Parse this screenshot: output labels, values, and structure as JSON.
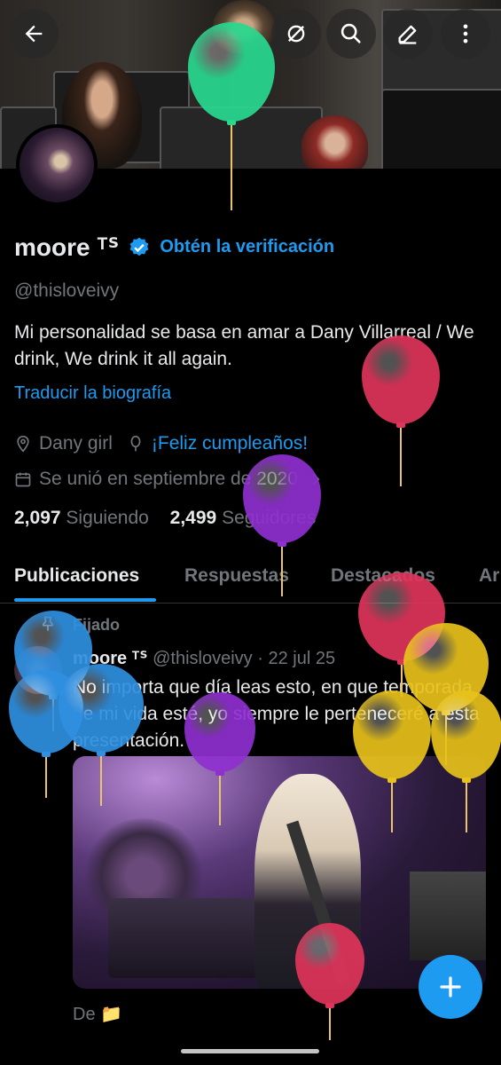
{
  "profile": {
    "name": "moore ᵀᔆ",
    "verify_label": "Obtén la verificación",
    "handle": "@thisloveivy",
    "bio": "Mi personalidad se basa en amar a Dany Villarreal / We drink, We drink it all again.",
    "translate_label": "Traducir la biografía",
    "location": "Dany girl",
    "birthday": "¡Feliz cumpleaños!",
    "joined": "Se unió en septiembre de 2020",
    "following_count": "2,097",
    "following_label": "Siguiendo",
    "followers_count": "2,499",
    "followers_label": "Seguidores"
  },
  "tabs": [
    {
      "label": "Publicaciones"
    },
    {
      "label": "Respuestas"
    },
    {
      "label": "Destacados"
    },
    {
      "label": "Ar"
    }
  ],
  "post": {
    "pinned_label": "Fijado",
    "author": "moore ᵀᔆ",
    "handle": "@thisloveivy",
    "separator": "·",
    "date": "22 jul 25",
    "text": "No importa que día leas esto, en que temporada de mi vida esté, yo siempre le perteneceré a esta presentación.",
    "footer": "De 📁"
  },
  "icons": {
    "back": "back-arrow-icon",
    "grok": "grok-icon",
    "search": "search-icon",
    "edit": "edit-icon",
    "more": "more-vertical-icon",
    "location": "location-pin-icon",
    "balloon": "birthday-balloon-icon",
    "calendar": "calendar-icon",
    "verified": "verified-badge-icon",
    "compose": "plus-icon"
  },
  "colors": {
    "accent": "#1d9bf0",
    "background": "#000000",
    "text": "#e7e9ea",
    "muted": "#71767b"
  }
}
